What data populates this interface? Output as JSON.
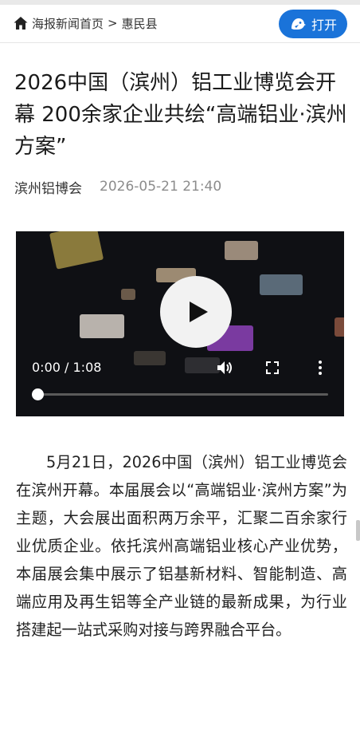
{
  "header": {
    "breadcrumb": {
      "home": "海报新闻首页",
      "separator": ">",
      "current": "惠民县"
    },
    "open_button": "打开",
    "accent_color": "#1a73d9"
  },
  "article": {
    "title": "2026中国（滨州）铝工业博览会开幕 200余家企业共绘“高端铝业·滨州方案”",
    "source": "滨州铝博会",
    "date": "2026-05-21 21:40",
    "paragraph": "5月21日，2026中国（滨州）铝工业博览会在滨州开幕。本届展会以“高端铝业·滨州方案”为主题，大会展出面积两万余平，汇聚二百余家行业优质企业。依托滨州高端铝业核心产业优势，本届展会集中展示了铝基新材料、智能制造、高端应用及再生铝等全产业链的最新成果，为行业搭建起一站式采购对接与跨界融合平台。"
  },
  "video": {
    "time_display": "0:00 / 1:08",
    "progress": 0,
    "icons": [
      "play-icon",
      "volume-icon",
      "fullscreen-icon",
      "more-options-icon"
    ]
  }
}
